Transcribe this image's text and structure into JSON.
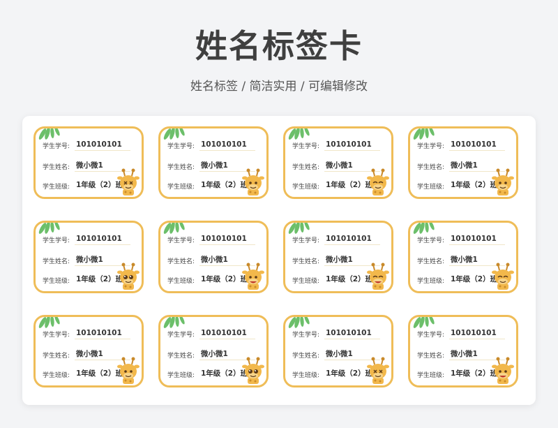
{
  "header": {
    "title": "姓名标签卡",
    "subtitle": "姓名标签 /  简洁实用  /  可编辑修改"
  },
  "labels": {
    "student_id": "学生学号:",
    "student_name": "学生姓名:",
    "student_class": "学生班级:"
  },
  "colors": {
    "card_border": "#efbd58",
    "leaf": "#6cbf6a",
    "giraffe": "#f2b84b"
  },
  "cards": [
    {
      "id": "101010101",
      "name": "微小微1",
      "class": "1年级（2）班",
      "face": "x-eyes"
    },
    {
      "id": "101010101",
      "name": "微小微1",
      "class": "1年级（2）班",
      "face": "happy"
    },
    {
      "id": "101010101",
      "name": "微小微1",
      "class": "1年级（2）班",
      "face": "squint"
    },
    {
      "id": "101010101",
      "name": "微小微1",
      "class": "1年级（2）班",
      "face": "calm"
    },
    {
      "id": "101010101",
      "name": "微小微1",
      "class": "1年级（2）班",
      "face": "wink"
    },
    {
      "id": "101010101",
      "name": "微小微1",
      "class": "1年级（2）班",
      "face": "sweat"
    },
    {
      "id": "101010101",
      "name": "微小微1",
      "class": "1年级（2）班",
      "face": "laugh"
    },
    {
      "id": "101010101",
      "name": "微小微1",
      "class": "1年级（2）班",
      "face": "sleepy"
    },
    {
      "id": "101010101",
      "name": "微小微1",
      "class": "1年级（2）班",
      "face": "smile"
    },
    {
      "id": "101010101",
      "name": "微小微1",
      "class": "1年级（2）班",
      "face": "big-eyes"
    },
    {
      "id": "101010101",
      "name": "微小微1",
      "class": "1年级（2）班",
      "face": "dizzy"
    },
    {
      "id": "101010101",
      "name": "微小微1",
      "class": "1年级（2）班",
      "face": "grin"
    }
  ]
}
